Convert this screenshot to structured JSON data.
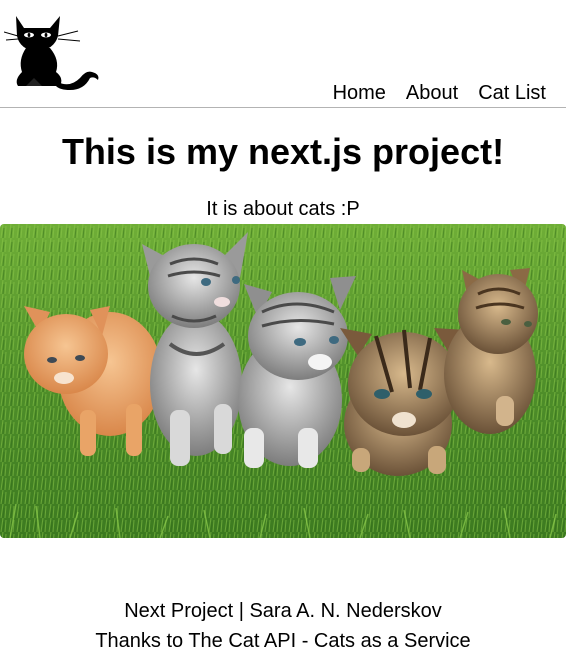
{
  "header": {
    "logo_icon": "black-cat-icon",
    "nav": [
      {
        "label": "Home"
      },
      {
        "label": "About"
      },
      {
        "label": "Cat List"
      }
    ]
  },
  "main": {
    "title": "This is my next.js project!",
    "subtitle": "It is about cats :P",
    "hero_image": {
      "icon": "kittens-photo",
      "description_colors": {
        "grass": "#4f8f2a",
        "grass_light": "#7cbc3f"
      }
    }
  },
  "footer": {
    "line1": "Next Project | Sara A. N. Nederskov",
    "line2": "Thanks to The Cat API - Cats as a Service"
  }
}
